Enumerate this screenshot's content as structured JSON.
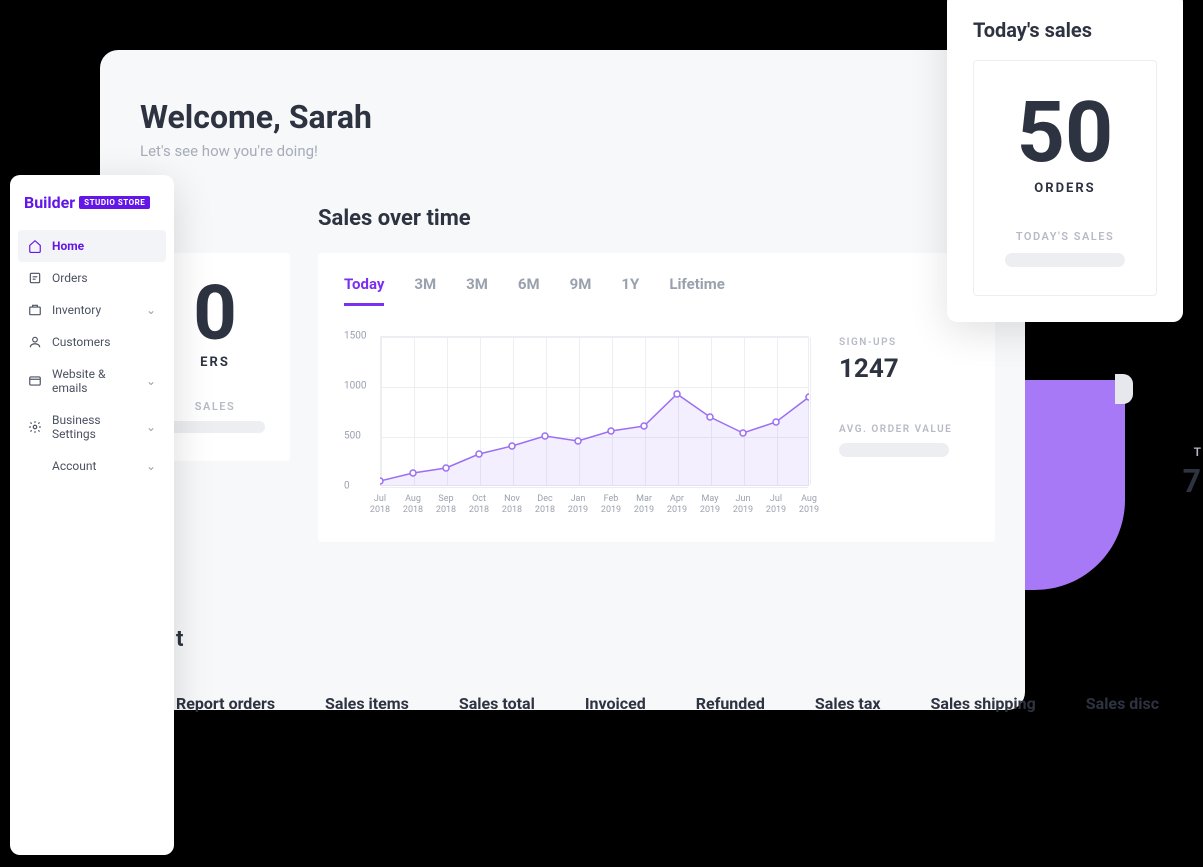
{
  "header": {
    "title": "Welcome, Sarah",
    "subtitle": "Let's see how you're doing!"
  },
  "sections": {
    "today_sales_title": "Today's sales",
    "sales_over_title": "Sales over time",
    "report_title": "t"
  },
  "today_peek": {
    "value": "0",
    "label": "ERS",
    "footer": "SALES"
  },
  "today_card": {
    "title": "Today's sales",
    "value": "50",
    "label": "ORDERS",
    "footer": "TODAY'S SALES"
  },
  "metrics": {
    "signups_label": "SIGN-UPS",
    "signups_value": "1247",
    "aov_label": "AVG. ORDER VALUE",
    "t_label": "T",
    "seven": "7"
  },
  "tabs": [
    "Today",
    "3M",
    "3M",
    "6M",
    "9M",
    "1Y",
    "Lifetime"
  ],
  "report_cols": [
    "Report orders",
    "Sales items",
    "Sales total",
    "Invoiced",
    "Refunded",
    "Sales tax",
    "Sales shipping",
    "Sales disc"
  ],
  "sidebar": {
    "logo_text": "Builder",
    "logo_badge": "STUDIO STORE",
    "items": [
      {
        "label": "Home",
        "icon": "home",
        "active": true,
        "expandable": false
      },
      {
        "label": "Orders",
        "icon": "orders",
        "active": false,
        "expandable": false
      },
      {
        "label": "Inventory",
        "icon": "inventory",
        "active": false,
        "expandable": true
      },
      {
        "label": "Customers",
        "icon": "customers",
        "active": false,
        "expandable": false
      },
      {
        "label": "Website & emails",
        "icon": "website",
        "active": false,
        "expandable": true
      },
      {
        "label": "Business Settings",
        "icon": "settings",
        "active": false,
        "expandable": true
      },
      {
        "label": "Account",
        "icon": "",
        "active": false,
        "expandable": true,
        "sub": true
      }
    ]
  },
  "chart_data": {
    "type": "line",
    "title": "Sales over time",
    "xlabel": "",
    "ylabel": "",
    "ylim": [
      0,
      1500
    ],
    "yticks": [
      0,
      500,
      1000,
      1500
    ],
    "categories": [
      "Jul 2018",
      "Aug 2018",
      "Sep 2018",
      "Oct 2018",
      "Nov 2018",
      "Dec 2018",
      "Jan 2019",
      "Feb 2019",
      "Mar 2019",
      "Apr 2019",
      "May 2019",
      "Jun 2019",
      "Jul 2019",
      "Aug 2019"
    ],
    "values": [
      50,
      130,
      180,
      320,
      400,
      500,
      450,
      550,
      600,
      920,
      690,
      530,
      640,
      890
    ]
  }
}
